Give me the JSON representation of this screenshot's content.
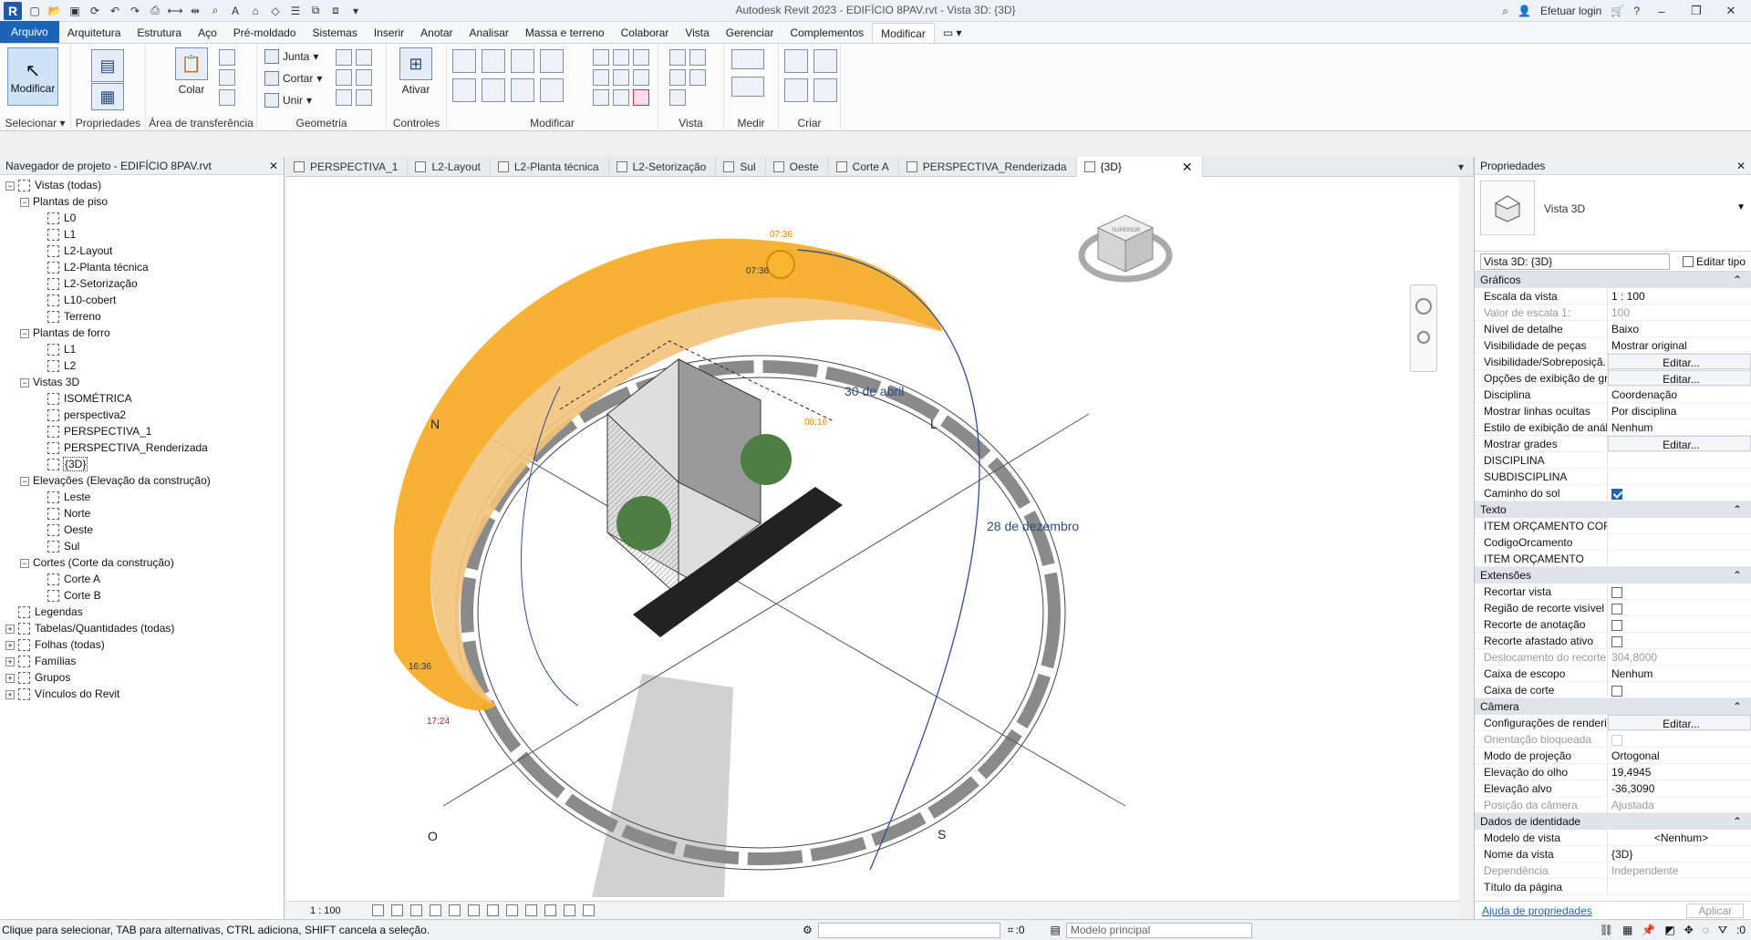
{
  "window": {
    "title": "Autodesk Revit 2023 - EDIFÍCIO 8PAV.rvt - Vista 3D: {3D}",
    "login": "Efetuar login"
  },
  "tabs": [
    "Arquivo",
    "Arquitetura",
    "Estrutura",
    "Aço",
    "Pré-moldado",
    "Sistemas",
    "Inserir",
    "Anotar",
    "Analisar",
    "Massa e terreno",
    "Colaborar",
    "Vista",
    "Gerenciar",
    "Complementos",
    "Modificar"
  ],
  "ribbon": {
    "selecionar": "Selecionar",
    "modificar": "Modificar",
    "propriedades": "Propriedades",
    "colar": "Colar",
    "area_transferencia": "Área de transferência",
    "junta": "Junta",
    "cortar": "Cortar",
    "unir": "Unir",
    "geometria": "Geometria",
    "ativar": "Ativar",
    "controles": "Controles",
    "modificar_panel": "Modificar",
    "vista": "Vista",
    "medir": "Medir",
    "criar": "Criar"
  },
  "browser": {
    "title": "Navegador de projeto - EDIFÍCIO 8PAV.rvt",
    "items": [
      {
        "label": "Vistas (todas)",
        "level": 0,
        "tog": "−",
        "icon": "views"
      },
      {
        "label": "Plantas de piso",
        "level": 1,
        "tog": "−"
      },
      {
        "label": "L0",
        "level": 2,
        "icon": "view"
      },
      {
        "label": "L1",
        "level": 2,
        "icon": "view"
      },
      {
        "label": "L2-Layout",
        "level": 2,
        "icon": "view"
      },
      {
        "label": "L2-Planta técnica",
        "level": 2,
        "icon": "view"
      },
      {
        "label": "L2-Setorização",
        "level": 2,
        "icon": "view"
      },
      {
        "label": "L10-cobert",
        "level": 2,
        "icon": "view"
      },
      {
        "label": "Terreno",
        "level": 2,
        "icon": "view"
      },
      {
        "label": "Plantas de forro",
        "level": 1,
        "tog": "−"
      },
      {
        "label": "L1",
        "level": 2,
        "icon": "view"
      },
      {
        "label": "L2",
        "level": 2,
        "icon": "view"
      },
      {
        "label": "Vistas 3D",
        "level": 1,
        "tog": "−"
      },
      {
        "label": "ISOMÉTRICA",
        "level": 2,
        "icon": "view"
      },
      {
        "label": "perspectiva2",
        "level": 2,
        "icon": "view"
      },
      {
        "label": "PERSPECTIVA_1",
        "level": 2,
        "icon": "view"
      },
      {
        "label": "PERSPECTIVA_Renderizada",
        "level": 2,
        "icon": "view"
      },
      {
        "label": "{3D}",
        "level": 2,
        "icon": "view",
        "selected": true
      },
      {
        "label": "Elevações (Elevação da construção)",
        "level": 1,
        "tog": "−"
      },
      {
        "label": "Leste",
        "level": 2,
        "icon": "view"
      },
      {
        "label": "Norte",
        "level": 2,
        "icon": "view"
      },
      {
        "label": "Oeste",
        "level": 2,
        "icon": "view"
      },
      {
        "label": "Sul",
        "level": 2,
        "icon": "view"
      },
      {
        "label": "Cortes (Corte da construção)",
        "level": 1,
        "tog": "−"
      },
      {
        "label": "Corte A",
        "level": 2,
        "icon": "view"
      },
      {
        "label": "Corte B",
        "level": 2,
        "icon": "view"
      },
      {
        "label": "Legendas",
        "level": 0,
        "icon": "legend"
      },
      {
        "label": "Tabelas/Quantidades (todas)",
        "level": 0,
        "tog": "+",
        "icon": "table"
      },
      {
        "label": "Folhas (todas)",
        "level": 0,
        "tog": "+",
        "icon": "sheet"
      },
      {
        "label": "Famílias",
        "level": 0,
        "tog": "+",
        "icon": "family"
      },
      {
        "label": "Grupos",
        "level": 0,
        "tog": "+",
        "icon": "group"
      },
      {
        "label": "Vínculos do Revit",
        "level": 0,
        "tog": "+",
        "icon": "link"
      }
    ]
  },
  "doc_tabs": [
    "PERSPECTIVA_1",
    "L2-Layout",
    "L2-Planta técnica",
    "L2-Setorização",
    "Sul",
    "Oeste",
    "Corte A",
    "PERSPECTIVA_Renderizada",
    "{3D}"
  ],
  "viewport": {
    "north": "N",
    "east": "L",
    "west": "O",
    "south": "S",
    "date1": "30 de abril",
    "date2": "28 de dezembro",
    "t1": "07:36",
    "t2": "07:36",
    "t3": "08:16",
    "t4": "16:36",
    "t5": "17:24",
    "cube_label": "SUPERIOR"
  },
  "view_control": {
    "scale": "1 : 100"
  },
  "properties": {
    "title": "Propriedades",
    "type_name": "Vista 3D",
    "instance": "Vista 3D: {3D}",
    "edit_type": "Editar tipo",
    "groups": [
      {
        "name": "Gráficos",
        "rows": [
          [
            "Escala da vista",
            "1 : 100",
            ""
          ],
          [
            "Valor de escala    1:",
            "100",
            "dim"
          ],
          [
            "Nível de detalhe",
            "Baixo",
            ""
          ],
          [
            "Visibilidade de peças",
            "Mostrar original",
            ""
          ],
          [
            "Visibilidade/Sobreposiçã...",
            "Editar...",
            "btn"
          ],
          [
            "Opções de exibição de gr...",
            "Editar...",
            "btn"
          ],
          [
            "Disciplina",
            "Coordenação",
            ""
          ],
          [
            "Mostrar linhas ocultas",
            "Por disciplina",
            ""
          ],
          [
            "Estilo de exibição de anál...",
            "Nenhum",
            ""
          ],
          [
            "Mostrar grades",
            "Editar...",
            "btn"
          ],
          [
            "DISCIPLINA",
            "",
            ""
          ],
          [
            "SUBDISCIPLINA",
            "",
            ""
          ],
          [
            "Caminho do sol",
            "",
            "checked"
          ]
        ]
      },
      {
        "name": "Texto",
        "rows": [
          [
            "ITEM ORÇAMENTO COR...",
            "",
            ""
          ],
          [
            "CodigoOrcamento",
            "",
            ""
          ],
          [
            "ITEM ORÇAMENTO",
            "",
            ""
          ]
        ]
      },
      {
        "name": "Extensões",
        "rows": [
          [
            "Recortar vista",
            "",
            "check"
          ],
          [
            "Região de recorte visível",
            "",
            "check"
          ],
          [
            "Recorte de anotação",
            "",
            "check"
          ],
          [
            "Recorte afastado ativo",
            "",
            "check"
          ],
          [
            "Deslocamento do recorte...",
            "304,8000",
            "dim"
          ],
          [
            "Caixa de escopo",
            "Nenhum",
            ""
          ],
          [
            "Caixa de corte",
            "",
            "check"
          ]
        ]
      },
      {
        "name": "Câmera",
        "rows": [
          [
            "Configurações de renderi...",
            "Editar...",
            "btn"
          ],
          [
            "Orientação bloqueada",
            "",
            "dimcheck"
          ],
          [
            "Modo de projeção",
            "Ortogonal",
            ""
          ],
          [
            "Elevação do olho",
            "19,4945",
            ""
          ],
          [
            "Elevação alvo",
            "-36,3090",
            ""
          ],
          [
            "Posição da câmera",
            "Ajustada",
            "dim"
          ]
        ]
      },
      {
        "name": "Dados de identidade",
        "rows": [
          [
            "Modelo de vista",
            "<Nenhum>",
            "center"
          ],
          [
            "Nome da vista",
            "{3D}",
            ""
          ],
          [
            "Dependência",
            "Independente",
            "dim"
          ],
          [
            "Título da página",
            "",
            ""
          ]
        ]
      }
    ],
    "help": "Ajuda de propriedades",
    "apply": "Aplicar"
  },
  "status": {
    "message": "Clique para selecionar, TAB para alternativas, CTRL adiciona, SHIFT cancela a seleção.",
    "zero": ":0",
    "model": "Modelo principal",
    "filter": ":0"
  }
}
